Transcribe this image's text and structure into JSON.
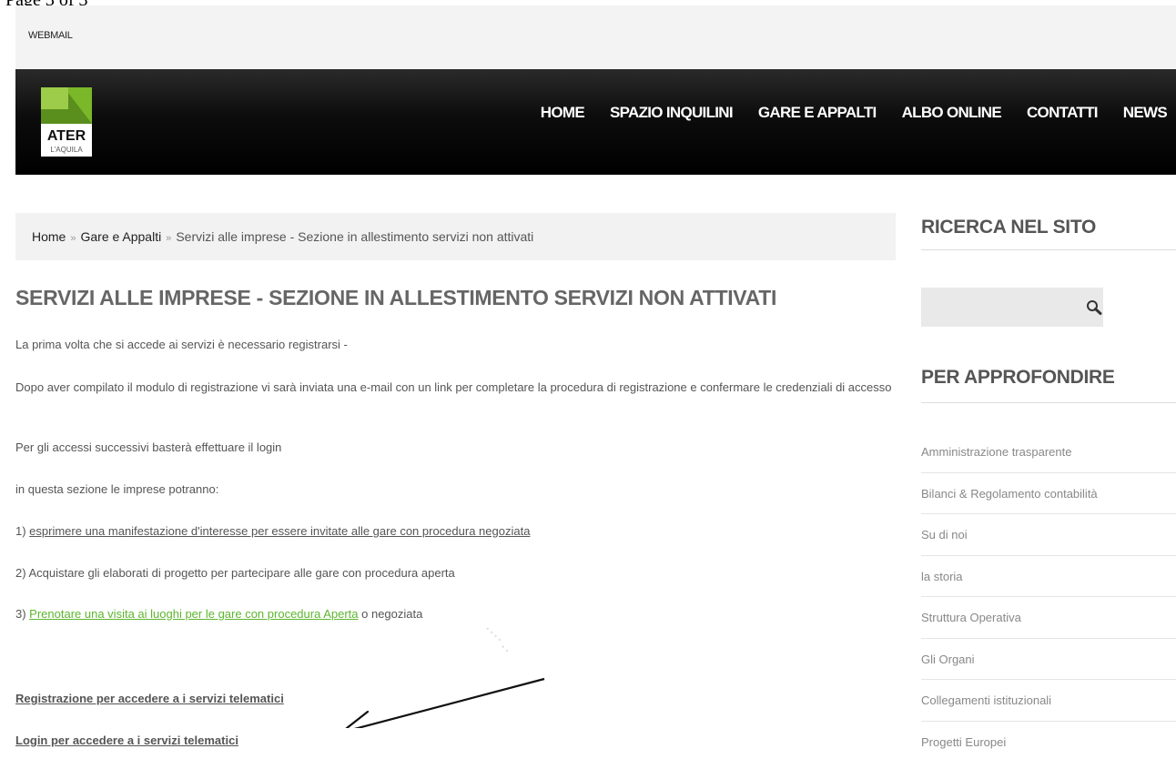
{
  "caption": "Page 3 of 3",
  "header": {
    "webmail": "WEBMAIL",
    "logo_text": "ATER",
    "logo_subtext": "L'AQUILA",
    "nav": [
      "HOME",
      "SPAZIO INQUILINI",
      "GARE E APPALTI",
      "ALBO ONLINE",
      "CONTATTI",
      "NEWS"
    ]
  },
  "breadcrumb": {
    "home": "Home",
    "section": "Gare e Appalti",
    "current": "Servizi alle imprese - Sezione in allestimento servizi non attivati",
    "separator": "»"
  },
  "main": {
    "title": "SERVIZI ALLE IMPRESE - SEZIONE IN ALLESTIMENTO SERVIZI NON ATTIVATI",
    "p1": "La prima volta che si accede ai servizi è necessario registrarsi -",
    "p2": "Dopo aver compilato il modulo di registrazione vi sarà inviata una e-mail con un link per completare la procedura di registrazione e confermare le credenziali di accesso",
    "p3": "Per gli accessi successivi basterà effettuare il login",
    "p4": "in questa sezione le imprese potranno:",
    "item1_prefix": "1) ",
    "item1_link": "esprimere una manifestazione d'interesse per essere invitate alle gare con procedura negoziata",
    "item2": "2) Acquistare gli elaborati di progetto per partecipare alle gare con procedura aperta",
    "item3_prefix": "3) ",
    "item3_link": "Prenotare una visita ai luoghi per le gare con procedura Aperta",
    "item3_suffix": " o negoziata",
    "register_link": "Registrazione per accedere a i servizi telematici",
    "login_link": "Login per accedere a i servizi telematici"
  },
  "sidebar": {
    "search_heading": "RICERCA NEL SITO",
    "search_placeholder": "",
    "more_heading": "PER APPROFONDIRE",
    "items": [
      "Amministrazione trasparente",
      "Bilanci & Regolamento contabilità",
      "Su di noi",
      "la storia",
      "Struttura Operativa",
      "Gli Organi",
      "Collegamenti istituzionali",
      "Progetti Europei"
    ]
  },
  "colors": {
    "logo_green": "#7ab829",
    "link_green": "#5db52f",
    "nav_bg": "#000000"
  }
}
